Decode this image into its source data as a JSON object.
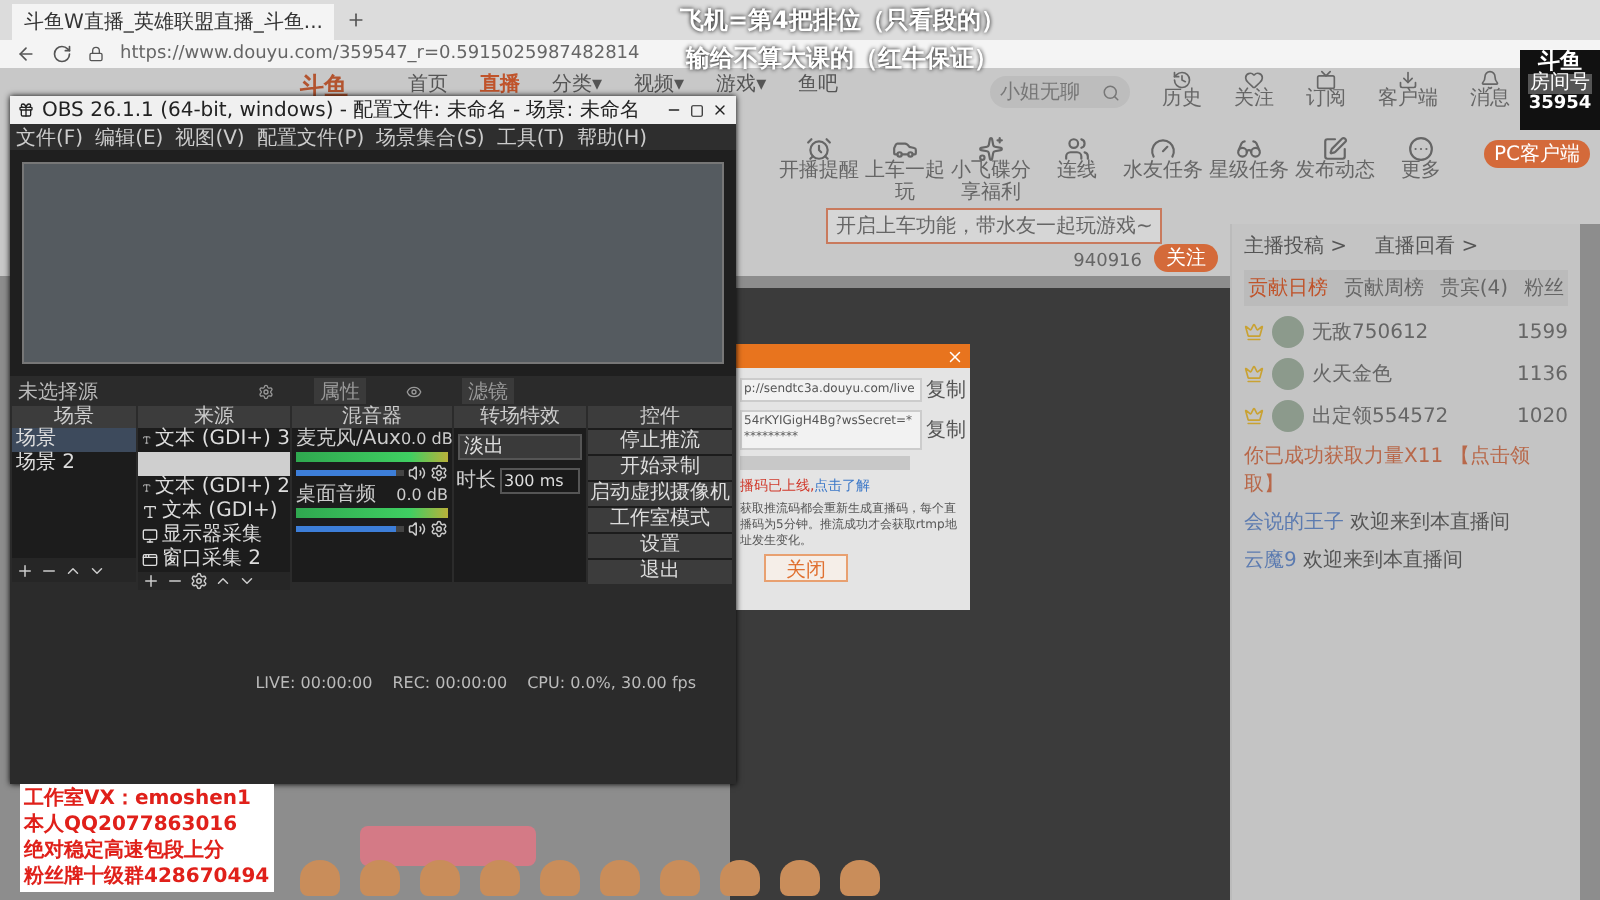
{
  "overlay_caption": [
    "飞机=第4把排位（只看段的）",
    "输给不算大课的（红牛保证）"
  ],
  "browser": {
    "tab_title": "斗鱼W直播_英雄联盟直播_斗鱼...",
    "url": "https://www.douyu.com/359547_r=0.5915025987482814"
  },
  "site": {
    "logo": "斗鱼",
    "nav": [
      {
        "label": "首页",
        "selected": false
      },
      {
        "label": "直播",
        "selected": true
      },
      {
        "label": "分类▾",
        "selected": false
      },
      {
        "label": "视频▾",
        "selected": false
      },
      {
        "label": "游戏▾",
        "selected": false
      },
      {
        "label": "鱼吧",
        "selected": false
      }
    ],
    "search_placeholder": "小姐无聊",
    "header_links": [
      {
        "kind": "history",
        "label": "历史"
      },
      {
        "kind": "heart",
        "label": "关注"
      },
      {
        "kind": "tv",
        "label": "订阅"
      },
      {
        "kind": "download",
        "label": "客户端"
      },
      {
        "kind": "bell",
        "label": "消息"
      }
    ],
    "tools": [
      {
        "kind": "alarm",
        "label": "开播提醒"
      },
      {
        "kind": "car",
        "label": "上车一起玩"
      },
      {
        "kind": "ufo",
        "label": "小飞碟分享福利"
      },
      {
        "kind": "people",
        "label": "连线"
      },
      {
        "kind": "gauge",
        "label": "水友任务"
      },
      {
        "kind": "glasses",
        "label": "星级任务"
      },
      {
        "kind": "edit",
        "label": "发布动态"
      },
      {
        "kind": "more",
        "label": "更多"
      }
    ],
    "pc_client_button": "PC客户端",
    "tooltip": "开启上车功能，带水友一起玩游戏~",
    "follow_count": "940916",
    "follow_button": "关注"
  },
  "chat": {
    "links": [
      "主播投稿 >",
      "直播回看 >"
    ],
    "tabs": [
      {
        "label": "贡献日榜",
        "selected": true
      },
      {
        "label": "贡献周榜",
        "selected": false
      },
      {
        "label": "贵宾(4)",
        "selected": false
      },
      {
        "label": "粉丝",
        "selected": false
      }
    ],
    "rank": [
      {
        "name": "无敌750612",
        "score": "1599"
      },
      {
        "name": "火天金色",
        "score": "1136"
      },
      {
        "name": "出定领554572",
        "score": "1020"
      }
    ],
    "notice": "你已成功获取力量X11 【点击领取】",
    "messages": [
      {
        "user": "会说的王子",
        "text": "欢迎来到本直播间"
      },
      {
        "user": "云魔9",
        "text": "欢迎来到本直播间"
      }
    ]
  },
  "room_badge": {
    "logo": "斗鱼",
    "label": "房间号",
    "room": "35954"
  },
  "obs": {
    "title": "OBS 26.1.1 (64-bit, windows) - 配置文件: 未命名 - 场景: 未命名",
    "menu": [
      "文件(F)",
      "编辑(E)",
      "视图(V)",
      "配置文件(P)",
      "场景集合(S)",
      "工具(T)",
      "帮助(H)"
    ],
    "source_status": "未选择源",
    "source_buttons": [
      "属性",
      "滤镜"
    ],
    "docks": [
      "场景",
      "来源",
      "混音器",
      "转场特效",
      "控件"
    ],
    "scenes": [
      {
        "label": "场景",
        "selected": true
      },
      {
        "label": "场景 2",
        "selected": false
      }
    ],
    "sources": [
      {
        "kind": "text",
        "label": "文本 (GDI+) 3",
        "selected": false
      },
      {
        "kind": "blank",
        "selected": true
      },
      {
        "kind": "text",
        "label": "文本 (GDI+) 2",
        "selected": false
      },
      {
        "kind": "text",
        "label": "文本 (GDI+)",
        "selected": false
      },
      {
        "kind": "monitor",
        "label": "显示器采集",
        "selected": false
      },
      {
        "kind": "window",
        "label": "窗口采集 2",
        "selected": false
      }
    ],
    "mixer": [
      {
        "name": "麦克风/Aux",
        "reading": "0.0 dB",
        "level": 0.93
      },
      {
        "name": "桌面音频",
        "reading": "0.0 dB",
        "level": 0.93
      }
    ],
    "transition": {
      "value": "淡出",
      "duration_label": "时长",
      "duration": "300 ms"
    },
    "controls": [
      "停止推流",
      "开始录制",
      "启动虚拟摄像机",
      "工作室模式",
      "设置",
      "退出"
    ],
    "status": {
      "live": "LIVE: 00:00:00",
      "rec": "REC: 00:00:00",
      "cpu": "CPU: 0.0%, 30.00 fps"
    }
  },
  "dialog": {
    "fields": [
      {
        "value": "p://sendtc3a.douyu.com/live",
        "copy": "复制"
      },
      {
        "value": "54rKYIGigH4Bg?wsSecret=**********",
        "copy": "复制"
      }
    ],
    "warning": "播码已上线,",
    "learn_more": "点击了解",
    "info": "获取推流码都会重新生成直播码，每个直播码为5分钟。推流成功才会获取rtmp地址发生变化。",
    "close": "关闭"
  },
  "ad": [
    "工作室VX：emoshen1",
    "本人QQ2077863016",
    "绝对稳定高速包段上分",
    "粉丝牌十级群428670494"
  ]
}
